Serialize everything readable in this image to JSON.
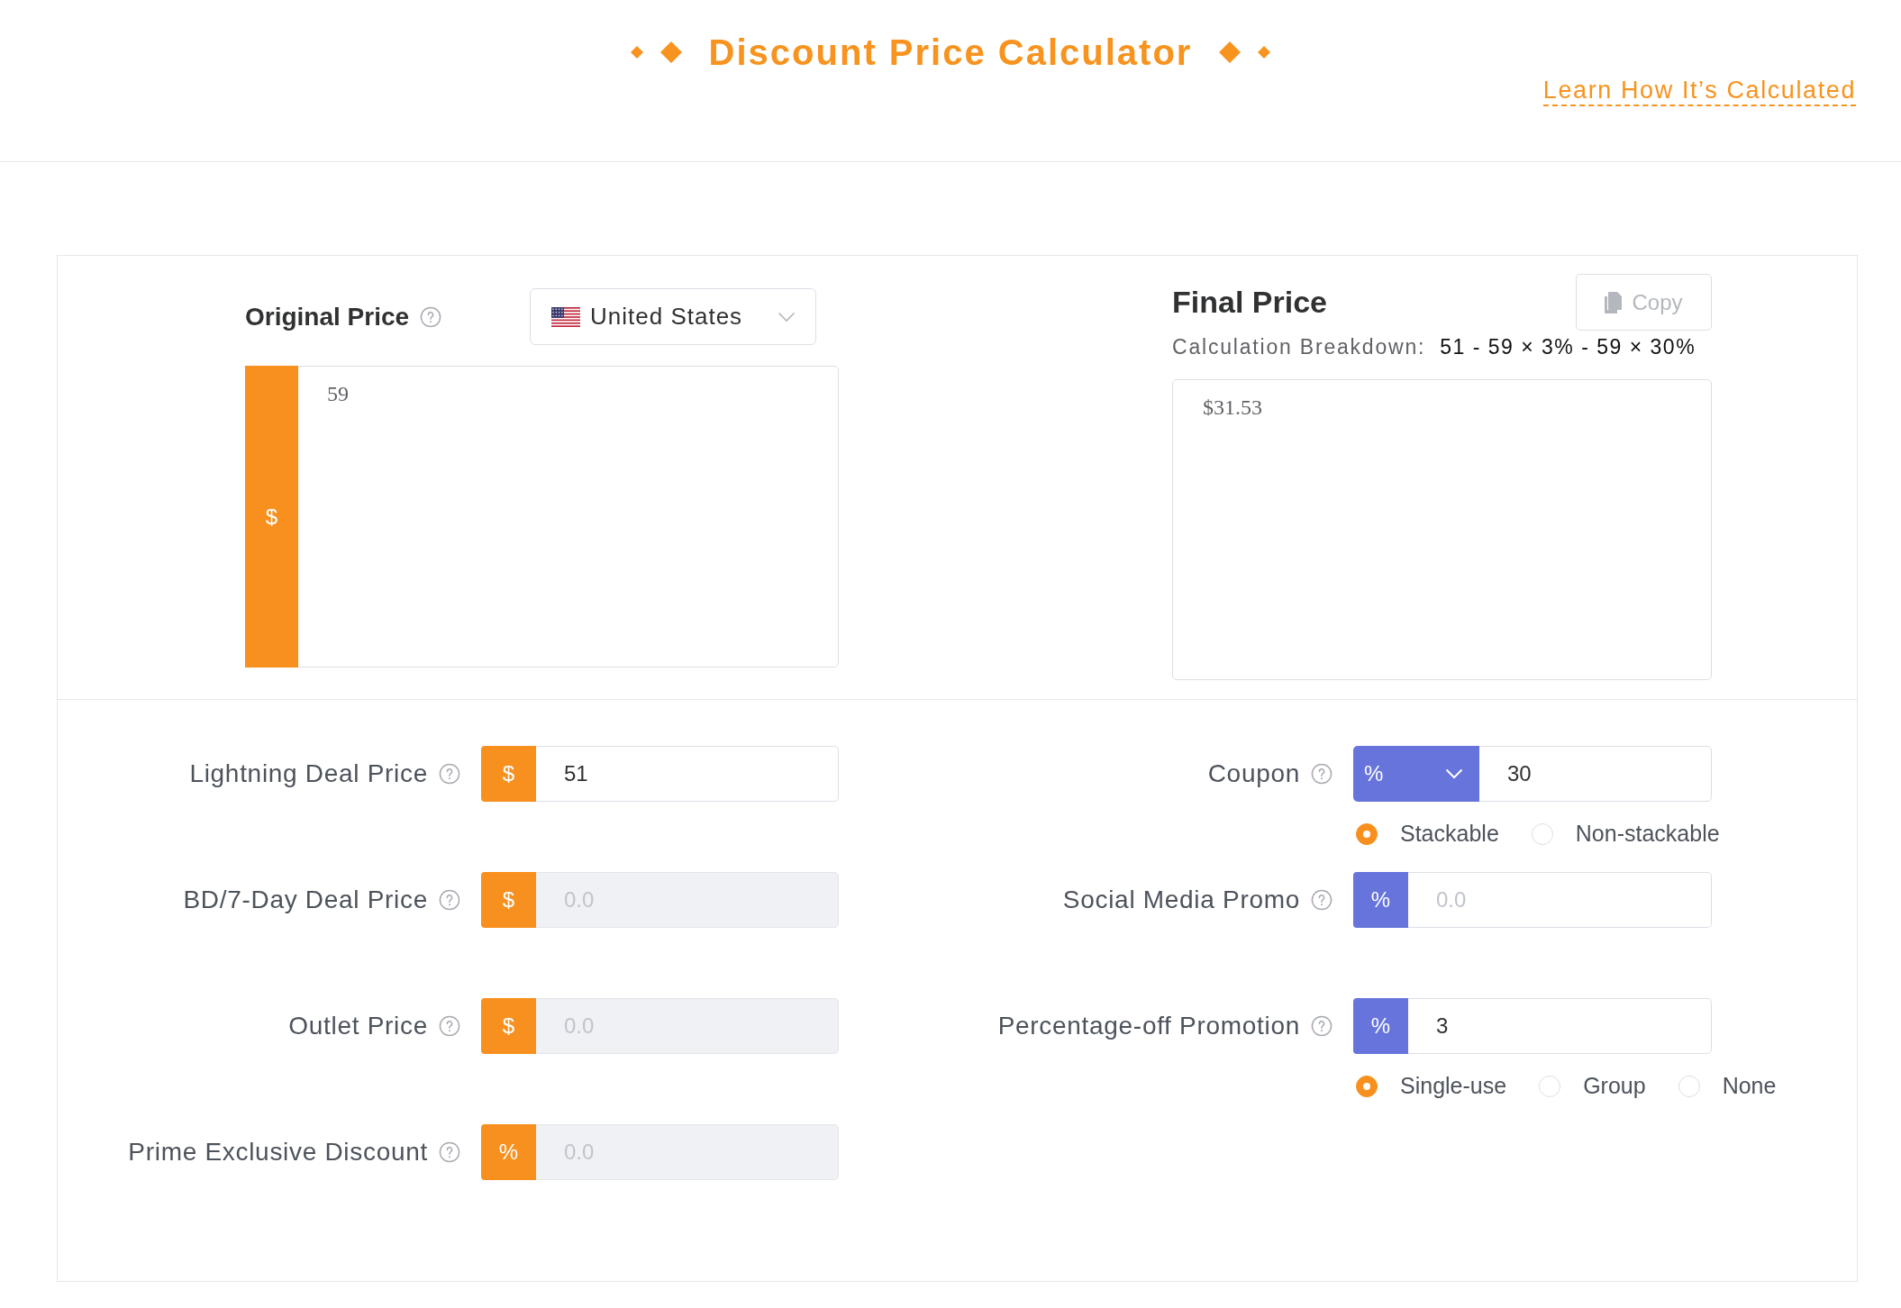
{
  "header": {
    "title": "Discount Price Calculator",
    "link": "Learn How It’s Calculated"
  },
  "original_price": {
    "label": "Original Price",
    "country": "United States",
    "unit": "$",
    "value": "59"
  },
  "final_price": {
    "title": "Final Price",
    "copy_button": {
      "label": "Copy",
      "disabled": true
    },
    "breakdown_label": "Calculation Breakdown:",
    "breakdown": "51 - 59 × 3% - 59 × 30%",
    "value": "$31.53"
  },
  "deal_fields": [
    {
      "label": "Lightning Deal Price",
      "unit": "$",
      "value": "51",
      "disabled": false
    },
    {
      "label": "BD/7-Day Deal Price",
      "unit": "$",
      "placeholder": "0.0",
      "disabled": true
    },
    {
      "label": "Outlet Price",
      "unit": "$",
      "placeholder": "0.0",
      "disabled": true
    },
    {
      "label": "Prime Exclusive Discount",
      "unit": "%",
      "placeholder": "0.0",
      "disabled": true
    }
  ],
  "promo_fields": [
    {
      "label": "Coupon",
      "kind": "dropdown",
      "unit": "%",
      "value": "30",
      "disabled": false,
      "radios": [
        {
          "label": "Stackable",
          "selected": true
        },
        {
          "label": "Non-stackable",
          "selected": false
        }
      ]
    },
    {
      "label": "Social Media Promo",
      "kind": "unit",
      "unit": "%",
      "placeholder": "0.0",
      "disabled": false
    },
    {
      "label": "Percentage-off Promotion",
      "kind": "unit",
      "unit": "%",
      "value": "3",
      "disabled": false,
      "radios": [
        {
          "label": "Single-use",
          "selected": true
        },
        {
          "label": "Group",
          "selected": false
        },
        {
          "label": "None",
          "selected": false
        }
      ]
    }
  ]
}
